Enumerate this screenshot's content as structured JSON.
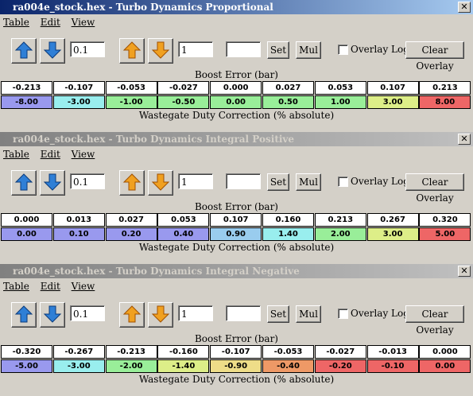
{
  "toolbar": {
    "step1": "0.1",
    "step2": "1",
    "set_value": "",
    "set_label": "Set",
    "mul_label": "Mul",
    "overlay_label": "Overlay Log",
    "clear_label": "Clear Overlay",
    "icons": [
      "arrow-up-blue-icon",
      "arrow-down-blue-icon",
      "arrow-up-orange-icon",
      "arrow-down-orange-icon"
    ]
  },
  "menu": [
    "Table",
    "Edit",
    "View"
  ],
  "windows": [
    {
      "title": "ra004e_stock.hex - Turbo Dynamics Proportional",
      "active": true,
      "x_axis_label": "Boost Error (bar)",
      "value_label": "Wastegate Duty Correction (% absolute)",
      "columns": [
        "-0.213",
        "-0.107",
        "-0.053",
        "-0.027",
        "0.000",
        "0.027",
        "0.053",
        "0.107",
        "0.213"
      ],
      "values": [
        "-8.00",
        "-3.00",
        "-1.00",
        "-0.50",
        "0.00",
        "0.50",
        "1.00",
        "3.00",
        "8.00"
      ],
      "colors": [
        "#9999ee",
        "#99eeee",
        "#99ee99",
        "#99ee99",
        "#99ee99",
        "#99ee99",
        "#99ee99",
        "#ddee88",
        "#ee6666"
      ]
    },
    {
      "title": "ra004e_stock.hex - Turbo Dynamics Integral Positive",
      "active": false,
      "x_axis_label": "Boost Error (bar)",
      "value_label": "Wastegate Duty Correction (% absolute)",
      "columns": [
        "0.000",
        "0.013",
        "0.027",
        "0.053",
        "0.107",
        "0.160",
        "0.213",
        "0.267",
        "0.320"
      ],
      "values": [
        "0.00",
        "0.10",
        "0.20",
        "0.40",
        "0.90",
        "1.40",
        "2.00",
        "3.00",
        "5.00"
      ],
      "colors": [
        "#9999ee",
        "#9999ee",
        "#9999ee",
        "#9999ee",
        "#99ccee",
        "#99eeee",
        "#99ee99",
        "#ddee88",
        "#ee6666"
      ]
    },
    {
      "title": "ra004e_stock.hex - Turbo Dynamics Integral Negative",
      "active": false,
      "x_axis_label": "Boost Error (bar)",
      "value_label": "Wastegate Duty Correction (% absolute)",
      "columns": [
        "-0.320",
        "-0.267",
        "-0.213",
        "-0.160",
        "-0.107",
        "-0.053",
        "-0.027",
        "-0.013",
        "0.000"
      ],
      "values": [
        "-5.00",
        "-3.00",
        "-2.00",
        "-1.40",
        "-0.90",
        "-0.40",
        "-0.20",
        "-0.10",
        "0.00"
      ],
      "colors": [
        "#9999ee",
        "#99eeee",
        "#99ee99",
        "#ddee88",
        "#eedd88",
        "#ee9966",
        "#ee6666",
        "#ee6666",
        "#ee6666"
      ]
    }
  ]
}
